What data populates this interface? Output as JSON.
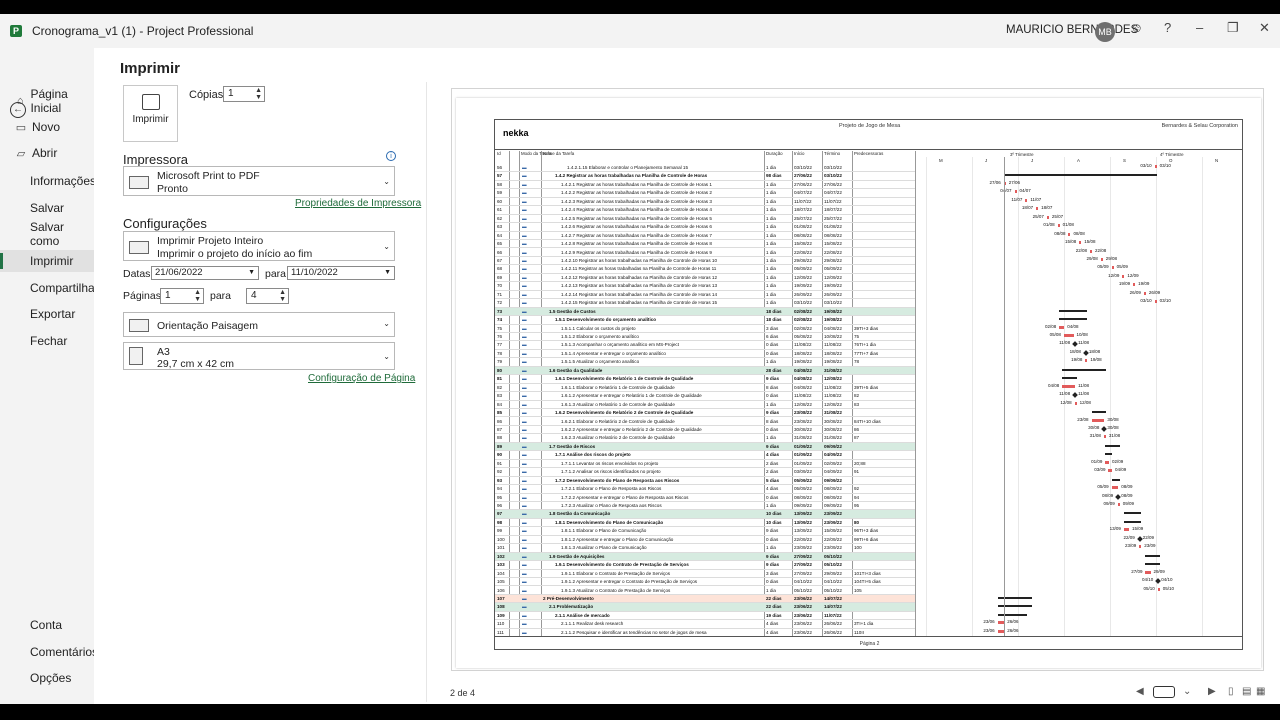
{
  "window": {
    "title": "Cronograma_v1 (1)  -  Project Professional",
    "user": "MAURICIO BERNARDES",
    "user_initials": "MB",
    "help": "?"
  },
  "nav": {
    "items": [
      {
        "label": "Página Inicial",
        "icon": "home-icon"
      },
      {
        "label": "Novo",
        "icon": "new-document-icon"
      },
      {
        "label": "Abrir",
        "icon": "folder-open-icon"
      },
      {
        "label": "Informações"
      },
      {
        "label": "Salvar"
      },
      {
        "label": "Salvar como"
      },
      {
        "label": "Imprimir"
      },
      {
        "label": "Compartilhar"
      },
      {
        "label": "Exportar"
      },
      {
        "label": "Fechar"
      }
    ],
    "bottom": [
      "Conta",
      "Comentários",
      "Opções"
    ]
  },
  "print": {
    "heading": "Imprimir",
    "button_label": "Imprimir",
    "copies_label": "Cópias:",
    "copies_value": "1",
    "printer_heading": "Impressora",
    "printer_name": "Microsoft Print to PDF",
    "printer_status": "Pronto",
    "printer_props_link": "Propriedades de Impressora",
    "settings_heading": "Configurações",
    "scope_title": "Imprimir Projeto Inteiro",
    "scope_desc": "Imprimir o projeto do início ao fim",
    "dates_label": "Datas:",
    "date_from": "21/06/2022",
    "date_to_label": "para",
    "date_to": "11/10/2022",
    "pages_label": "Páginas:",
    "page_from": "1",
    "page_to_label": "para",
    "page_to": "4",
    "orientation": "Orientação Paisagem",
    "paper_name": "A3",
    "paper_size": "29,7 cm x 42 cm",
    "page_setup_link": "Configuração de Página"
  },
  "preview": {
    "logo": "nekka",
    "project_title": "Projeto de Jogo de Mesa",
    "corp": "Bernardes & Selau Corporation",
    "col_headers": {
      "id": "Id",
      "mode": "Modo da Tarefa",
      "name": "Nome da Tarefa",
      "dur": "Duração",
      "start": "Início",
      "end": "Término",
      "pred": "Predecessoras"
    },
    "timescale": [
      "M",
      "J",
      "J",
      "A",
      "S",
      "O",
      "N"
    ],
    "trimester_3": "3º Trimestre",
    "trimester_4": "4º Trimestre",
    "footer": "Página 2",
    "page_indicator": "2 de 4",
    "rows": [
      {
        "id": "56",
        "name": "1.4.2.1.15 Elaborar e controlar o Planejamento Semanal 15",
        "dur": "1 dia",
        "start": "03/10/22",
        "end": "03/10/22",
        "pred": "",
        "lvl": 5
      },
      {
        "id": "57",
        "name": "1.4.2 Registrar as horas trabalhadas na Planilha de Controle de Horas",
        "dur": "98 dias",
        "start": "27/06/22",
        "end": "03/10/22",
        "pred": "",
        "lvl": 3,
        "bold": true
      },
      {
        "id": "58",
        "name": "1.4.2.1 Registrar as horas trabalhadas na Planilha de Controle de Horas 1",
        "dur": "1 dia",
        "start": "27/06/22",
        "end": "27/06/22",
        "pred": "",
        "lvl": 4
      },
      {
        "id": "59",
        "name": "1.4.2.2 Registrar as horas trabalhadas na Planilha de Controle de Horas 2",
        "dur": "1 dia",
        "start": "04/07/22",
        "end": "04/07/22",
        "pred": "",
        "lvl": 4
      },
      {
        "id": "60",
        "name": "1.4.2.3 Registrar as horas trabalhadas na Planilha de Controle de Horas 3",
        "dur": "1 dia",
        "start": "11/07/22",
        "end": "11/07/22",
        "pred": "",
        "lvl": 4
      },
      {
        "id": "61",
        "name": "1.4.2.4 Registrar as horas trabalhadas na Planilha de Controle de Horas 4",
        "dur": "1 dia",
        "start": "18/07/22",
        "end": "18/07/22",
        "pred": "",
        "lvl": 4
      },
      {
        "id": "62",
        "name": "1.4.2.5 Registrar as horas trabalhadas na Planilha de Controle de Horas 5",
        "dur": "1 dia",
        "start": "25/07/22",
        "end": "25/07/22",
        "pred": "",
        "lvl": 4
      },
      {
        "id": "63",
        "name": "1.4.2.6 Registrar as horas trabalhadas na Planilha de Controle de Horas 6",
        "dur": "1 dia",
        "start": "01/08/22",
        "end": "01/08/22",
        "pred": "",
        "lvl": 4
      },
      {
        "id": "64",
        "name": "1.4.2.7 Registrar as horas trabalhadas na Planilha de Controle de Horas 7",
        "dur": "1 dia",
        "start": "08/08/22",
        "end": "08/08/22",
        "pred": "",
        "lvl": 4
      },
      {
        "id": "65",
        "name": "1.4.2.8 Registrar as horas trabalhadas na Planilha de Controle de Horas 8",
        "dur": "1 dia",
        "start": "15/08/22",
        "end": "15/08/22",
        "pred": "",
        "lvl": 4
      },
      {
        "id": "66",
        "name": "1.4.2.9 Registrar as horas trabalhadas na Planilha de Controle de Horas 9",
        "dur": "1 dia",
        "start": "22/08/22",
        "end": "22/08/22",
        "pred": "",
        "lvl": 4
      },
      {
        "id": "67",
        "name": "1.4.2.10 Registrar as horas trabalhadas na Planilha de Controle de Horas 10",
        "dur": "1 dia",
        "start": "29/08/22",
        "end": "29/08/22",
        "pred": "",
        "lvl": 4
      },
      {
        "id": "68",
        "name": "1.4.2.11 Registrar as horas trabalhadas na Planilha de Controle de Horas 11",
        "dur": "1 dia",
        "start": "05/09/22",
        "end": "05/09/22",
        "pred": "",
        "lvl": 4
      },
      {
        "id": "69",
        "name": "1.4.2.12 Registrar as horas trabalhadas na Planilha de Controle de Horas 12",
        "dur": "1 dia",
        "start": "12/09/22",
        "end": "12/09/22",
        "pred": "",
        "lvl": 4
      },
      {
        "id": "70",
        "name": "1.4.2.13 Registrar as horas trabalhadas na Planilha de Controle de Horas 13",
        "dur": "1 dia",
        "start": "19/09/22",
        "end": "19/09/22",
        "pred": "",
        "lvl": 4
      },
      {
        "id": "71",
        "name": "1.4.2.14 Registrar as horas trabalhadas na Planilha de Controle de Horas 14",
        "dur": "1 dia",
        "start": "26/09/22",
        "end": "26/09/22",
        "pred": "",
        "lvl": 4
      },
      {
        "id": "72",
        "name": "1.4.2.15 Registrar as horas trabalhadas na Planilha de Controle de Horas 15",
        "dur": "1 dia",
        "start": "03/10/22",
        "end": "03/10/22",
        "pred": "",
        "lvl": 4
      },
      {
        "id": "73",
        "name": "1.5 Gestão de Custos",
        "dur": "18 dias",
        "start": "02/08/22",
        "end": "19/08/22",
        "pred": "",
        "lvl": 2,
        "bold": true,
        "sum": 1
      },
      {
        "id": "74",
        "name": "1.5.1 Desenvolvimento do orçamento analítico",
        "dur": "18 dias",
        "start": "02/08/22",
        "end": "19/08/22",
        "pred": "",
        "lvl": 3,
        "bold": true
      },
      {
        "id": "75",
        "name": "1.5.1.1 Calcular os custos do projeto",
        "dur": "3 dias",
        "start": "02/08/22",
        "end": "04/08/22",
        "pred": "39TI+3 dias",
        "lvl": 4
      },
      {
        "id": "76",
        "name": "1.5.1.2 Elaborar o orçamento analítico",
        "dur": "6 dias",
        "start": "05/08/22",
        "end": "10/08/22",
        "pred": "75",
        "lvl": 4
      },
      {
        "id": "77",
        "name": "1.5.1.3 Acompanhar o orçamento analítico em MS-Project",
        "dur": "0 dias",
        "start": "11/08/22",
        "end": "11/08/22",
        "pred": "76TI+1 dia",
        "lvl": 4
      },
      {
        "id": "78",
        "name": "1.5.1.4 Apresentar e entregar o orçamento analítico",
        "dur": "0 dias",
        "start": "18/08/22",
        "end": "18/08/22",
        "pred": "77TI+7 dias",
        "lvl": 4
      },
      {
        "id": "79",
        "name": "1.5.1.5 Atualizar o orçamento analítico",
        "dur": "1 dia",
        "start": "19/08/22",
        "end": "19/08/22",
        "pred": "78",
        "lvl": 4
      },
      {
        "id": "80",
        "name": "1.6 Gestão da Qualidade",
        "dur": "28 dias",
        "start": "04/08/22",
        "end": "31/08/22",
        "pred": "",
        "lvl": 2,
        "bold": true,
        "sum": 1
      },
      {
        "id": "81",
        "name": "1.6.1 Desenvolvimento do Relatório 1 de Controle de Qualidade",
        "dur": "9 dias",
        "start": "04/08/22",
        "end": "12/08/22",
        "pred": "",
        "lvl": 3,
        "bold": true
      },
      {
        "id": "82",
        "name": "1.6.1.1 Elaborar o Relatório 1 de Controle de Qualidade",
        "dur": "8 dias",
        "start": "04/08/22",
        "end": "11/08/22",
        "pred": "39TI+5 dias",
        "lvl": 4
      },
      {
        "id": "83",
        "name": "1.6.1.2 Apresentar e entregar o Relatório 1 de Controle de Qualidade",
        "dur": "0 dias",
        "start": "11/08/22",
        "end": "11/08/22",
        "pred": "82",
        "lvl": 4
      },
      {
        "id": "84",
        "name": "1.6.1.3 Atualizar o Relatório 1 de Controle de Qualidade",
        "dur": "1 dia",
        "start": "12/08/22",
        "end": "12/08/22",
        "pred": "83",
        "lvl": 4
      },
      {
        "id": "85",
        "name": "1.6.2 Desenvolvimento do Relatório 2 de Controle de Qualidade",
        "dur": "9 dias",
        "start": "23/08/22",
        "end": "31/08/22",
        "pred": "",
        "lvl": 3,
        "bold": true
      },
      {
        "id": "86",
        "name": "1.6.2.1 Elaborar o Relatório 2 de Controle de Qualidade",
        "dur": "8 dias",
        "start": "23/08/22",
        "end": "30/08/22",
        "pred": "84TI+10 dias",
        "lvl": 4
      },
      {
        "id": "87",
        "name": "1.6.2.2 Apresentar e entregar o Relatório 2 de Controle de Qualidade",
        "dur": "0 dias",
        "start": "30/08/22",
        "end": "30/08/22",
        "pred": "86",
        "lvl": 4
      },
      {
        "id": "88",
        "name": "1.6.2.3 Atualizar o Relatório 2 de Controle de Qualidade",
        "dur": "1 dia",
        "start": "31/08/22",
        "end": "31/08/22",
        "pred": "87",
        "lvl": 4
      },
      {
        "id": "89",
        "name": "1.7 Gestão de Riscos",
        "dur": "9 dias",
        "start": "01/09/22",
        "end": "09/09/22",
        "pred": "",
        "lvl": 2,
        "bold": true,
        "sum": 1
      },
      {
        "id": "90",
        "name": "1.7.1 Análise dos riscos do projeto",
        "dur": "4 dias",
        "start": "01/09/22",
        "end": "04/09/22",
        "pred": "",
        "lvl": 3,
        "bold": true
      },
      {
        "id": "91",
        "name": "1.7.1.1 Levantar os riscos envolvidos no projeto",
        "dur": "2 dias",
        "start": "01/09/22",
        "end": "02/09/22",
        "pred": "20;88",
        "lvl": 4
      },
      {
        "id": "92",
        "name": "1.7.1.2 Analisar os riscos identificados no projeto",
        "dur": "2 dias",
        "start": "03/09/22",
        "end": "04/09/22",
        "pred": "91",
        "lvl": 4
      },
      {
        "id": "93",
        "name": "1.7.2 Desenvolvimento do Plano de Resposta aos Riscos",
        "dur": "5 dias",
        "start": "05/09/22",
        "end": "09/09/22",
        "pred": "",
        "lvl": 3,
        "bold": true
      },
      {
        "id": "94",
        "name": "1.7.2.1 Elaborar o Plano de Resposta aos Riscos",
        "dur": "4 dias",
        "start": "05/09/22",
        "end": "08/09/22",
        "pred": "92",
        "lvl": 4
      },
      {
        "id": "95",
        "name": "1.7.2.2 Apresentar e entregar o Plano de Resposta aos Riscos",
        "dur": "0 dias",
        "start": "08/09/22",
        "end": "08/09/22",
        "pred": "94",
        "lvl": 4
      },
      {
        "id": "96",
        "name": "1.7.2.3 Atualizar o Plano de Resposta aos Riscos",
        "dur": "1 dia",
        "start": "09/09/22",
        "end": "09/09/22",
        "pred": "95",
        "lvl": 4
      },
      {
        "id": "97",
        "name": "1.8 Gestão da Comunicação",
        "dur": "10 dias",
        "start": "13/09/22",
        "end": "23/09/22",
        "pred": "",
        "lvl": 2,
        "bold": true,
        "sum": 1
      },
      {
        "id": "98",
        "name": "1.8.1 Desenvolvimento do Plano de Comunicação",
        "dur": "10 dias",
        "start": "13/09/22",
        "end": "23/09/22",
        "pred": "80",
        "lvl": 3,
        "bold": true
      },
      {
        "id": "99",
        "name": "1.8.1.1 Elaborar o Plano de Comunicação",
        "dur": "9 dias",
        "start": "13/09/22",
        "end": "15/09/22",
        "pred": "96TI+3 dias",
        "lvl": 4
      },
      {
        "id": "100",
        "name": "1.8.1.2 Apresentar e entregar o Plano de Comunicação",
        "dur": "0 dias",
        "start": "22/09/22",
        "end": "22/09/22",
        "pred": "99TI+6 dias",
        "lvl": 4
      },
      {
        "id": "101",
        "name": "1.8.1.3 Atualizar o Plano de Comunicação",
        "dur": "1 dia",
        "start": "23/09/22",
        "end": "23/09/22",
        "pred": "100",
        "lvl": 4
      },
      {
        "id": "102",
        "name": "1.9 Gestão de Aquisições",
        "dur": "9 dias",
        "start": "27/09/22",
        "end": "05/10/22",
        "pred": "",
        "lvl": 2,
        "bold": true,
        "sum": 1
      },
      {
        "id": "103",
        "name": "1.9.1 Desenvolvimento do Contrato de Prestação de Serviços",
        "dur": "9 dias",
        "start": "27/09/22",
        "end": "05/10/22",
        "pred": "",
        "lvl": 3,
        "bold": true
      },
      {
        "id": "104",
        "name": "1.9.1.1 Elaborar o Contrato de Prestação de Serviços",
        "dur": "3 dias",
        "start": "27/09/22",
        "end": "29/09/22",
        "pred": "101TI+3 dias",
        "lvl": 4
      },
      {
        "id": "105",
        "name": "1.9.1.2 Apresentar e entregar o Contrato de Prestação de Serviços",
        "dur": "0 dias",
        "start": "04/10/22",
        "end": "04/10/22",
        "pred": "104TI+5 dias",
        "lvl": 4
      },
      {
        "id": "106",
        "name": "1.9.1.3 Atualizar o Contrato de Prestação de Serviços",
        "dur": "1 dia",
        "start": "05/10/22",
        "end": "05/10/22",
        "pred": "105",
        "lvl": 4
      },
      {
        "id": "107",
        "name": "2 Pré-Desenvolvimento",
        "dur": "22 dias",
        "start": "23/06/22",
        "end": "14/07/22",
        "pred": "",
        "lvl": 1,
        "bold": true,
        "sum": 3
      },
      {
        "id": "108",
        "name": "2.1 Problematização",
        "dur": "22 dias",
        "start": "23/06/22",
        "end": "14/07/22",
        "pred": "",
        "lvl": 2,
        "bold": true,
        "sum": 1
      },
      {
        "id": "109",
        "name": "2.1.1 Análise de mercado",
        "dur": "19 dias",
        "start": "23/06/22",
        "end": "11/07/22",
        "pred": "",
        "lvl": 3,
        "bold": true
      },
      {
        "id": "110",
        "name": "2.1.1.1 Realizar desk research",
        "dur": "4 dias",
        "start": "23/06/22",
        "end": "26/06/22",
        "pred": "3TI+1 dia",
        "lvl": 4
      },
      {
        "id": "111",
        "name": "2.1.1.2 Pesquisar e identificar as tendências no setor de jogos de mesa",
        "dur": "4 dias",
        "start": "23/06/22",
        "end": "26/06/22",
        "pred": "110II",
        "lvl": 4
      }
    ]
  }
}
